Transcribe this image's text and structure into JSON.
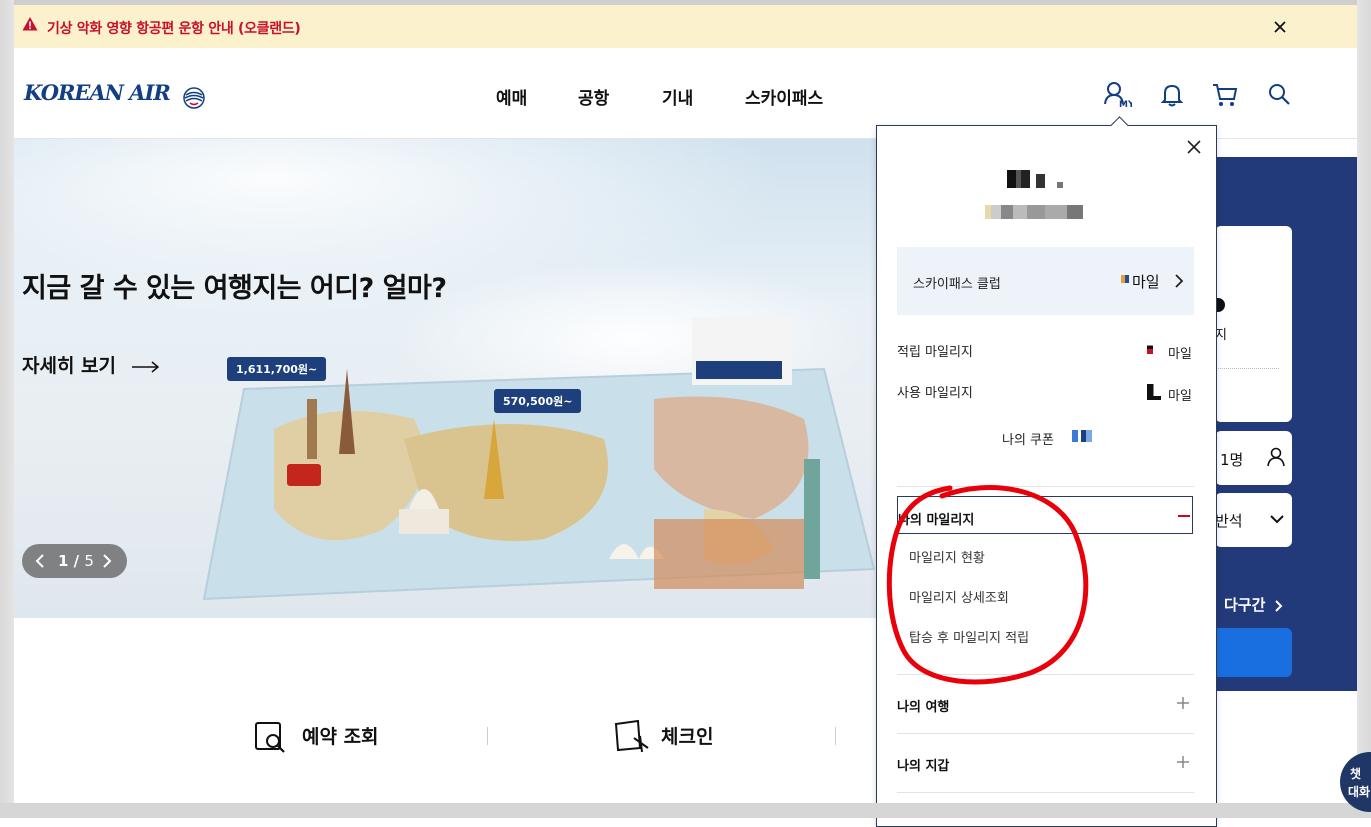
{
  "alert": {
    "text": "기상 악화 영향 항공편 운항 안내 (오클랜드)",
    "close_icon": "close-icon",
    "warning_icon": "warning-icon",
    "color": "#c8102e"
  },
  "header": {
    "logo_text": "KOREAN AIR",
    "logo_tag": "SKYTEAM",
    "nav": [
      "예매",
      "공항",
      "기내",
      "스카이패스"
    ],
    "icons": [
      "my-page-icon",
      "bell-icon",
      "cart-icon",
      "search-icon"
    ],
    "my_label": "MY"
  },
  "hero": {
    "title": "지금 갈 수 있는 여행지는 어디? 얼마?",
    "link": "자세히 보기",
    "prices": [
      "1,611,700원~",
      "570,500원~"
    ],
    "pager": {
      "current": "1",
      "total": "5",
      "separator": "/"
    }
  },
  "booking_panel": {
    "passengers": "1명",
    "seat_class": "반석",
    "multi_city": "다구간",
    "partial_text": "지"
  },
  "quick_links": [
    "예약 조회",
    "체크인"
  ],
  "popup": {
    "skypass_label": "스카이패스 클럽",
    "mile_unit": "마일",
    "earned_label": "적립 마일리지",
    "used_label": "사용 마일리지",
    "coupon_label": "나의 쿠폰",
    "sections": [
      {
        "title": "나의 마일리지",
        "expanded": true,
        "toggle": "−",
        "items": [
          "마일리지 현황",
          "마일리지 상세조회",
          "탑승 후 마일리지 적립"
        ]
      },
      {
        "title": "나의 여행",
        "expanded": false,
        "toggle": "+"
      },
      {
        "title": "나의 지갑",
        "expanded": false,
        "toggle": "+"
      }
    ]
  },
  "chat": {
    "line1": "챗",
    "line2": "대화"
  },
  "colors": {
    "brand": "#123e84",
    "panel_blue": "#233a7a",
    "button_blue": "#1a6fe0",
    "annotation": "#e8000b"
  }
}
